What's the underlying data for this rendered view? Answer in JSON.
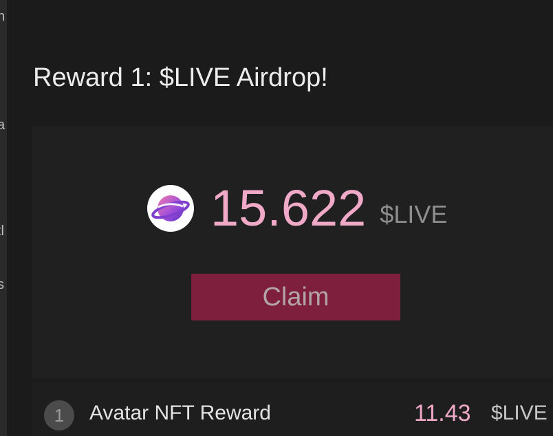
{
  "left_edge_glyphs": [
    "n",
    "a",
    "tl",
    "s",
    "l"
  ],
  "reward": {
    "title": "Reward 1: $LIVE Airdrop!",
    "amount": "15.622",
    "unit": "$LIVE",
    "claim_label": "Claim",
    "token_icon": "planet-logo-icon"
  },
  "reward_list": [
    {
      "index": "1",
      "name": "Avatar NFT Reward",
      "amount": "11.43",
      "unit": "$LIVE"
    }
  ],
  "colors": {
    "background": "#1b1b1b",
    "card": "#202020",
    "accent_pink": "#f1a9c8",
    "button": "#7e1f3e"
  }
}
